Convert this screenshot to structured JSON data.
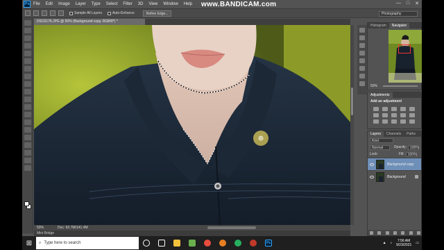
{
  "app": {
    "logo": "Ps",
    "menu": [
      "File",
      "Edit",
      "Image",
      "Layer",
      "Type",
      "Select",
      "Filter",
      "3D",
      "View",
      "Window",
      "Help"
    ],
    "watermark": "www.BANDICAM.com",
    "window_controls": [
      "—",
      "□",
      "✕"
    ]
  },
  "options_bar": {
    "sample_all_layers": "Sample All Layers",
    "auto_enhance": "Auto-Enhance",
    "refine_edge": "Refine Edge...",
    "workspace": "Photography"
  },
  "document": {
    "tab_title": "DSC6176.JPG @ 50% (Background copy, RGB/8*) *",
    "zoom": "50%",
    "doc_info": "Doc: 60.7M/141.4M"
  },
  "mini_bridge": "Mini Bridge",
  "navigator": {
    "tabs": [
      "Histogram",
      "Navigator"
    ],
    "active_tab": "Navigator",
    "zoom": "50%"
  },
  "adjustments": {
    "tab": "Adjustments",
    "title": "Add an adjustment"
  },
  "layers": {
    "tabs": [
      "Layers",
      "Channels",
      "Paths"
    ],
    "active_tab": "Layers",
    "kind": "Kind",
    "blend_mode": "Normal",
    "opacity_label": "Opacity:",
    "opacity": "100%",
    "lock_label": "Lock:",
    "fill_label": "Fill:",
    "fill": "100%",
    "items": [
      {
        "name": "Background copy",
        "selected": true
      },
      {
        "name": "Background",
        "selected": false
      }
    ]
  },
  "taskbar": {
    "search_placeholder": "Type here to search",
    "time": "7:56 AM",
    "date": "9/23/2021"
  },
  "colors": {
    "ps_bg": "#535353",
    "selected_layer": "#6e8fb8",
    "taskbar": "#1f1f1f"
  }
}
